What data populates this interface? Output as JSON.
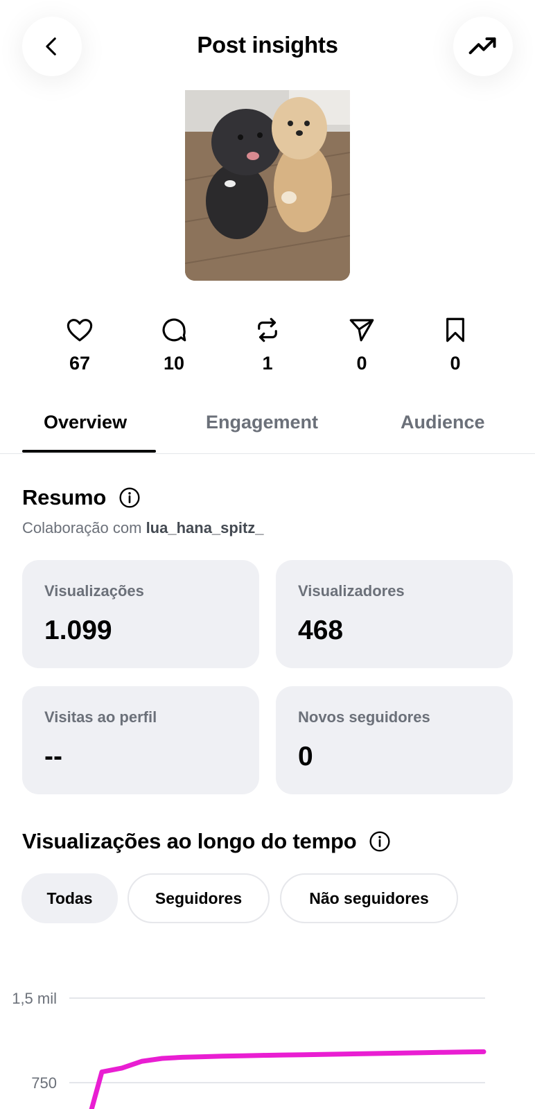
{
  "header": {
    "title": "Post insights",
    "back_icon": "chevron-left-icon",
    "trend_icon": "trending-up-icon"
  },
  "post_thumbnail": {
    "alt": ""
  },
  "stats": [
    {
      "icon": "heart-icon",
      "value": "67"
    },
    {
      "icon": "comment-icon",
      "value": "10"
    },
    {
      "icon": "repost-icon",
      "value": "1"
    },
    {
      "icon": "send-icon",
      "value": "0"
    },
    {
      "icon": "bookmark-icon",
      "value": "0"
    }
  ],
  "tabs": [
    {
      "label": "Overview",
      "active": true
    },
    {
      "label": "Engagement",
      "active": false
    },
    {
      "label": "Audience",
      "active": false
    }
  ],
  "summary": {
    "title": "Resumo",
    "subtitle_prefix": "Colaboração com",
    "collaborator": "lua_hana_spitz_",
    "cards": [
      {
        "label": "Visualizações",
        "value": "1.099"
      },
      {
        "label": "Visualizadores",
        "value": "468"
      },
      {
        "label": "Visitas ao perfil",
        "value": "--"
      },
      {
        "label": "Novos seguidores",
        "value": "0"
      }
    ]
  },
  "views_over_time": {
    "title": "Visualizações ao longo do tempo",
    "filters": [
      {
        "label": "Todas",
        "active": true
      },
      {
        "label": "Seguidores",
        "active": false
      },
      {
        "label": "Não seguidores",
        "active": false
      }
    ]
  },
  "chart_data": {
    "type": "line",
    "y_ticks": [
      "1,5 mil",
      "750"
    ],
    "ylim": [
      0,
      1500
    ],
    "series": [
      {
        "color": "#e91ed2",
        "x": [
          0,
          1,
          2,
          3,
          4,
          5,
          6,
          7,
          8,
          9,
          10,
          11,
          12,
          13,
          14,
          15,
          16,
          17,
          18,
          19,
          20
        ],
        "values": [
          200,
          845,
          880,
          940,
          965,
          975,
          980,
          985,
          988,
          992,
          995,
          998,
          1001,
          1004,
          1007,
          1010,
          1013,
          1016,
          1019,
          1022,
          1024
        ]
      }
    ]
  },
  "colors": {
    "accent_line": "#e91ed2",
    "card_bg": "#eff0f4",
    "muted_text": "#6b7079"
  }
}
